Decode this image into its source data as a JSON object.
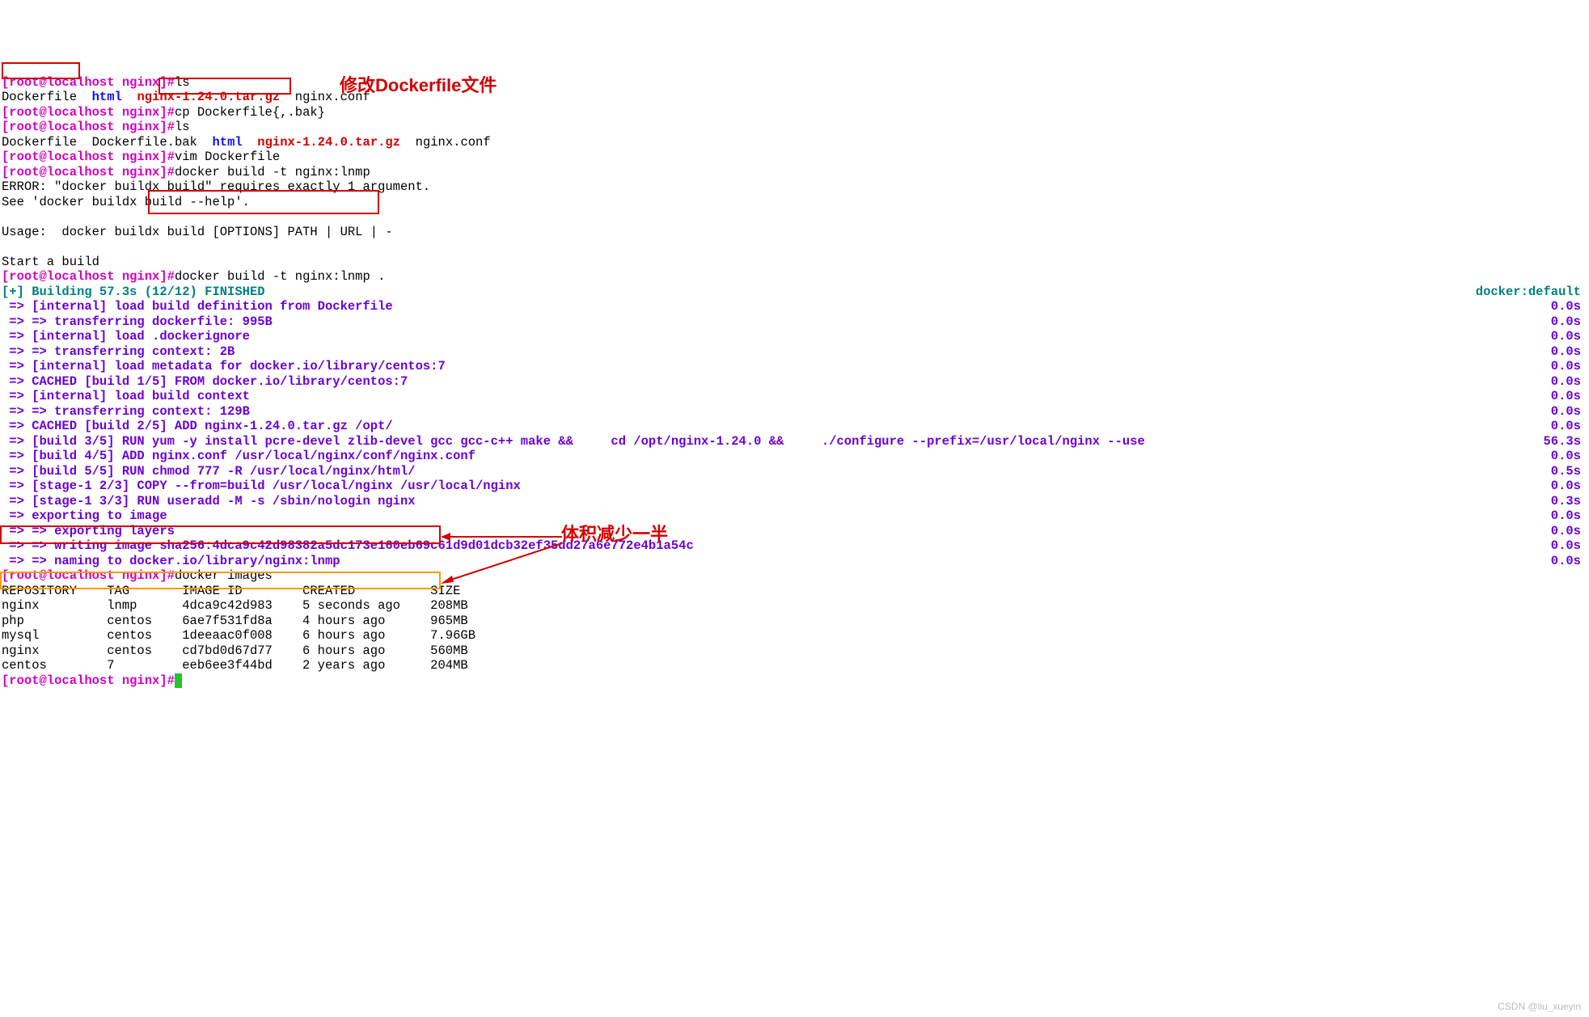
{
  "prompt": "[root@localhost nginx]#",
  "cmds": {
    "ls1": "ls",
    "cp": "cp Dockerfile{,.bak}",
    "ls2": "ls",
    "vim": "vim Dockerfile",
    "build1": "docker build -t nginx:lnmp",
    "build2": "docker build -t nginx:lnmp .",
    "images": "docker images"
  },
  "ls_out1": {
    "f1": "Dockerfile",
    "f2": "html",
    "f3": "nginx-1.24.0.tar.gz",
    "f4": "nginx.conf"
  },
  "ls_out2": {
    "f1": "Dockerfile",
    "f2": "Dockerfile.bak",
    "f3": "html",
    "f4": "nginx-1.24.0.tar.gz",
    "f5": "nginx.conf"
  },
  "error": {
    "l1": "ERROR: \"docker buildx build\" requires exactly 1 argument.",
    "l2": "See 'docker buildx build --help'.",
    "l3": "Usage:  docker buildx build [OPTIONS] PATH | URL | -",
    "l4": "Start a build"
  },
  "build": {
    "header_left": "[+] Building 57.3s (12/12) FINISHED",
    "header_right": "docker:default",
    "steps": [
      {
        "text": " => [internal] load build definition from Dockerfile",
        "time": "0.0s"
      },
      {
        "text": " => => transferring dockerfile: 995B",
        "time": "0.0s"
      },
      {
        "text": " => [internal] load .dockerignore",
        "time": "0.0s"
      },
      {
        "text": " => => transferring context: 2B",
        "time": "0.0s"
      },
      {
        "text": " => [internal] load metadata for docker.io/library/centos:7",
        "time": "0.0s"
      },
      {
        "text": " => CACHED [build 1/5] FROM docker.io/library/centos:7",
        "time": "0.0s"
      },
      {
        "text": " => [internal] load build context",
        "time": "0.0s"
      },
      {
        "text": " => => transferring context: 129B",
        "time": "0.0s"
      },
      {
        "text": " => CACHED [build 2/5] ADD nginx-1.24.0.tar.gz /opt/",
        "time": "0.0s"
      },
      {
        "text": " => [build 3/5] RUN yum -y install pcre-devel zlib-devel gcc gcc-c++ make &&     cd /opt/nginx-1.24.0 &&     ./configure --prefix=/usr/local/nginx --use",
        "time": "56.3s"
      },
      {
        "text": " => [build 4/5] ADD nginx.conf /usr/local/nginx/conf/nginx.conf",
        "time": "0.0s"
      },
      {
        "text": " => [build 5/5] RUN chmod 777 -R /usr/local/nginx/html/",
        "time": "0.5s"
      },
      {
        "text": " => [stage-1 2/3] COPY --from=build /usr/local/nginx /usr/local/nginx",
        "time": "0.0s"
      },
      {
        "text": " => [stage-1 3/3] RUN useradd -M -s /sbin/nologin nginx",
        "time": "0.3s"
      },
      {
        "text": " => exporting to image",
        "time": "0.0s"
      },
      {
        "text": " => => exporting layers",
        "time": "0.0s"
      },
      {
        "text": " => => writing image sha256:4dca9c42d98382a5dc173e160eb69c61d9d01dcb32ef35dd27a6e772e4b1a54c",
        "time": "0.0s"
      },
      {
        "text": " => => naming to docker.io/library/nginx:lnmp",
        "time": "0.0s"
      }
    ]
  },
  "images_table": {
    "header": [
      "REPOSITORY",
      "TAG",
      "IMAGE ID",
      "CREATED",
      "SIZE"
    ],
    "rows": [
      [
        "nginx",
        "lnmp",
        "4dca9c42d983",
        "5 seconds ago",
        "208MB"
      ],
      [
        "php",
        "centos",
        "6ae7f531fd8a",
        "4 hours ago",
        "965MB"
      ],
      [
        "mysql",
        "centos",
        "1deeaac0f008",
        "6 hours ago",
        "7.96GB"
      ],
      [
        "nginx",
        "centos",
        "cd7bd0d67d77",
        "6 hours ago",
        "560MB"
      ],
      [
        "centos",
        "7",
        "eeb6ee3f44bd",
        "2 years ago",
        "204MB"
      ]
    ]
  },
  "annot": {
    "a1": "修改Dockerfile文件",
    "a2": "体积减少一半"
  },
  "watermark": "CSDN @liu_xueyin"
}
